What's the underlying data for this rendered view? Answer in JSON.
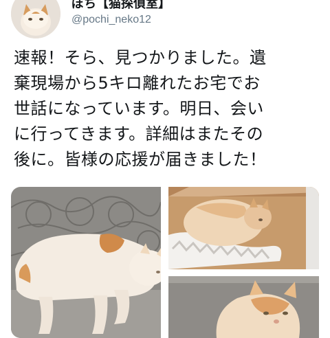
{
  "tweet": {
    "author_name": "ぽち【猫探偵室】",
    "handle": "@pochi_neko12",
    "text_lines": [
      "速報！そら、見つかりました。遺",
      "棄現場から5キロ離れたお宅でお",
      "世話になっています。明日、会い",
      "に行ってきます。詳細はまたその",
      "後に。皆様の応援が届きました！"
    ]
  },
  "media": {
    "photos": [
      {
        "subject": "cream-and-white cat lying on stone pavement"
      },
      {
        "subject": "cat curled up in a cardboard box on a white cloth"
      },
      {
        "subject": "cat walking on concrete"
      }
    ]
  },
  "colors": {
    "text": "#14171a",
    "handle": "#657786",
    "cat_fur": "#f4e4cf",
    "cat_orange": "#d9a067"
  }
}
